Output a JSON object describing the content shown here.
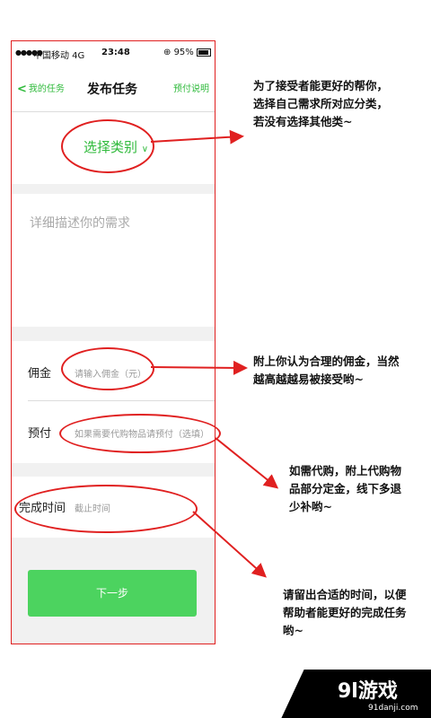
{
  "status_bar": {
    "signal": "●●●●●",
    "carrier": "中国移动 4G",
    "time": "23:48",
    "battery": "⊕ 95%"
  },
  "nav": {
    "back_label": "我的任务",
    "title": "发布任务",
    "right_label": "预付说明"
  },
  "category": {
    "label": "选择类别",
    "chevron": "∨"
  },
  "description": {
    "placeholder": "详细描述你的需求"
  },
  "commission": {
    "label": "佣金",
    "placeholder": "请输入佣金（元）"
  },
  "prepay": {
    "label": "预付",
    "placeholder": "如果需要代购物品请预付（选填）"
  },
  "deadline": {
    "label": "完成时间",
    "placeholder": "截止时间"
  },
  "next_button": {
    "label": "下一步"
  },
  "notes": {
    "category": [
      "为了接受者能更好的帮你，",
      "选择自己需求所对应分类，",
      "若没有选择其他类~"
    ],
    "commission": [
      "附上你认为合理的佣金，当然",
      "越高越越易被接受哟~"
    ],
    "prepay": [
      "如需代购，附上代购物",
      "品部分定金，线下多退",
      "少补哟~"
    ],
    "deadline": [
      "请留出合适的时间，以便",
      "帮助者能更好的完成任务",
      "哟~"
    ]
  },
  "annotation_color": "#e02020",
  "accent_color": "#2fba3b",
  "watermark": {
    "logo": "9l游戏",
    "url": "91danji.com"
  }
}
